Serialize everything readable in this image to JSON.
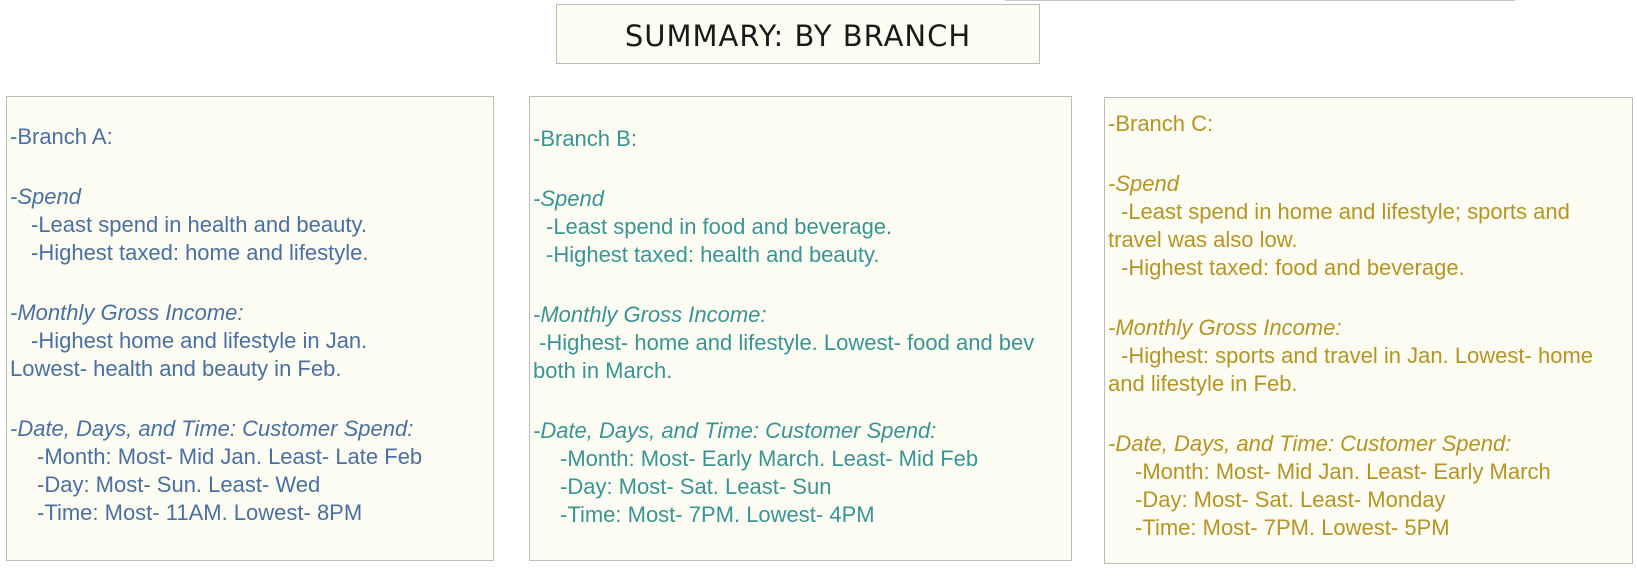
{
  "title": "SUMMARY: BY BRANCH",
  "panels": {
    "a": {
      "branch": "-Branch A:",
      "spend_heading": "-Spend",
      "spend_lines": [
        "-Least spend in health and beauty.",
        "-Highest taxed: home and lifestyle."
      ],
      "income_heading": "-Monthly Gross Income:",
      "income_text": "-Highest home and lifestyle in Jan. Lowest- health and beauty in Feb.",
      "date_heading": "-Date, Days, and Time: Customer Spend:",
      "date_lines": [
        "-Month: Most- Mid Jan. Least- Late Feb",
        "-Day: Most- Sun. Least- Wed",
        "-Time: Most- 11AM. Lowest- 8PM"
      ],
      "color": "#4a6fa0"
    },
    "b": {
      "branch": "-Branch B:",
      "spend_heading": "-Spend",
      "spend_lines": [
        "-Least spend in food and beverage.",
        "-Highest taxed: health and beauty."
      ],
      "income_heading": "-Monthly Gross Income:",
      "income_text": "-Highest- home and lifestyle. Lowest- food and bev both in March.",
      "date_heading": "-Date, Days, and Time: Customer Spend:",
      "date_lines": [
        "-Month: Most- Early March. Least- Mid Feb",
        "-Day: Most- Sat. Least- Sun",
        "-Time: Most- 7PM. Lowest- 4PM"
      ],
      "color": "#3a9493"
    },
    "c": {
      "branch": "-Branch C:",
      "spend_heading": "-Spend",
      "spend_text": "-Least spend in home and lifestyle; sports and travel was also low.",
      "spend_lines": [
        "-Highest taxed: food and beverage."
      ],
      "income_heading": "-Monthly Gross Income:",
      "income_text": "-Highest: sports and travel in Jan. Lowest- home and lifestyle in Feb.",
      "date_heading": "-Date, Days, and Time: Customer Spend:",
      "date_lines": [
        "-Month: Most- Mid Jan. Least- Early March",
        "-Day: Most- Sat. Least- Monday",
        "-Time: Most- 7PM. Lowest- 5PM"
      ],
      "color": "#b59426"
    }
  }
}
